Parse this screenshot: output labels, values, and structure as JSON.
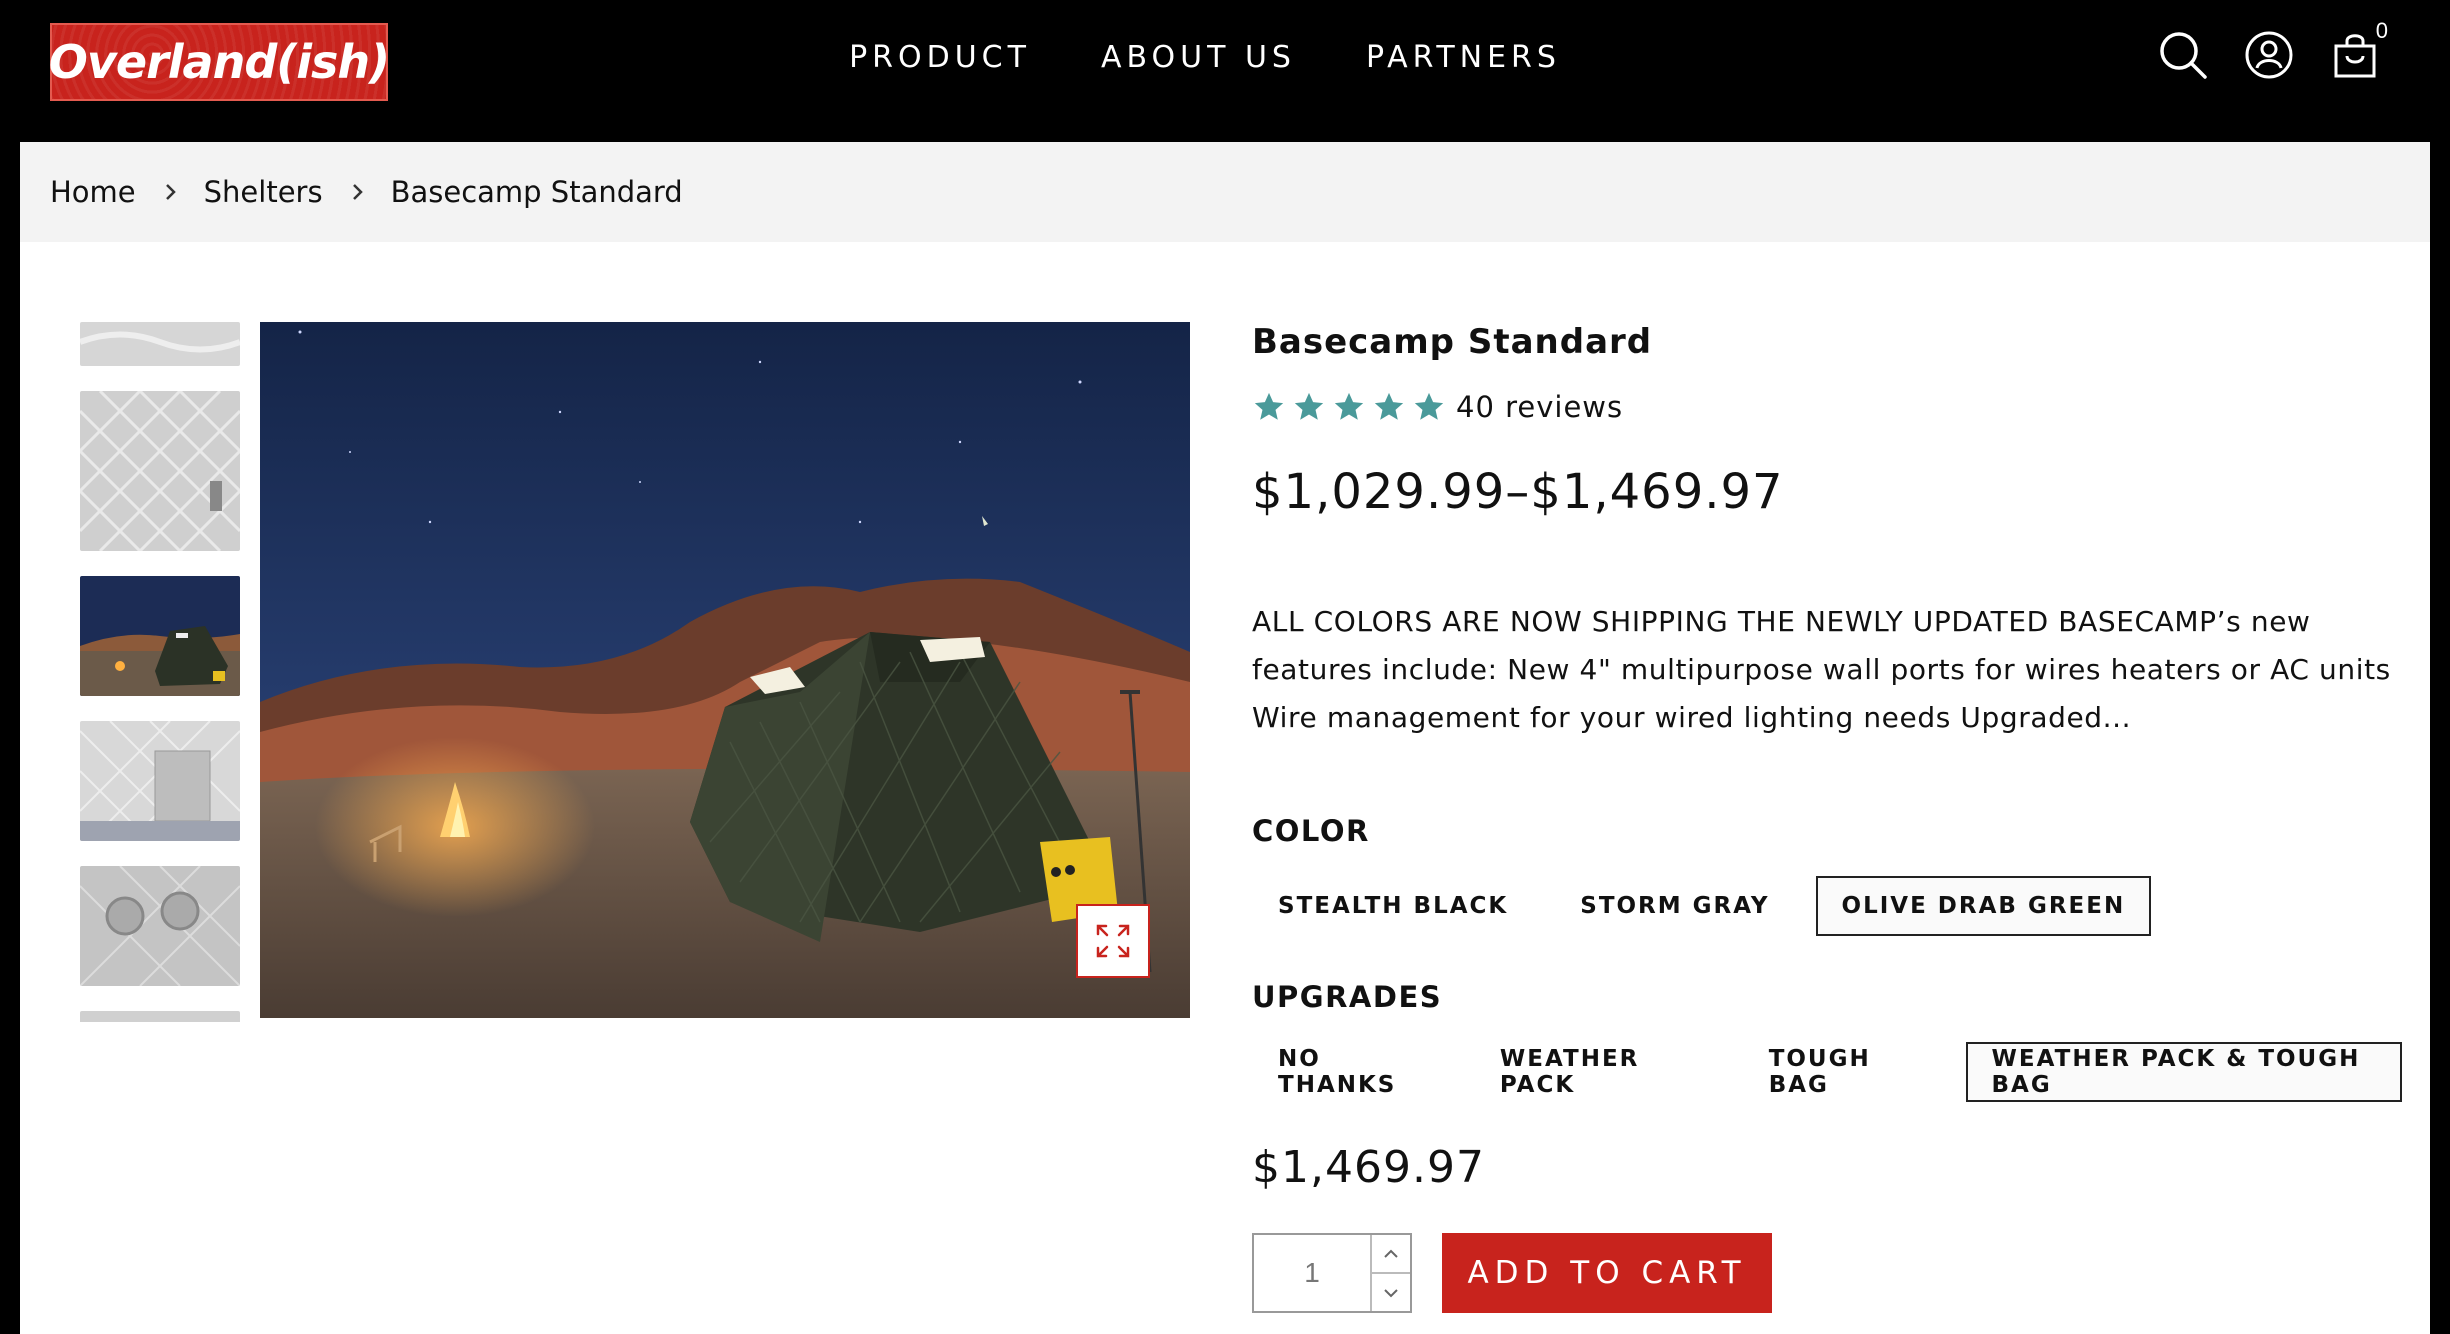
{
  "header": {
    "logo_text": "Overland(ish)",
    "nav": [
      "PRODUCT",
      "ABOUT US",
      "PARTNERS"
    ],
    "cart_count": "0"
  },
  "breadcrumb": [
    "Home",
    "Shelters",
    "Basecamp Standard"
  ],
  "product": {
    "title": "Basecamp Standard",
    "rating": 5,
    "reviews": "40 reviews",
    "price_range": "$1,029.99–$1,469.97",
    "description": "ALL COLORS ARE NOW SHIPPING THE NEWLY UPDATED BASECAMP’s new features include: New 4\" multipurpose wall ports for wires heaters or AC units Wire management for your wired lighting needs Upgraded...",
    "color_label": "COLOR",
    "colors": [
      "STEALTH BLACK",
      "STORM GRAY",
      "OLIVE DRAB GREEN"
    ],
    "selected_color": "OLIVE DRAB GREEN",
    "upgrades_label": "UPGRADES",
    "upgrades": [
      "NO THANKS",
      "WEATHER PACK",
      "TOUGH BAG",
      "WEATHER PACK & TOUGH BAG"
    ],
    "selected_upgrade": "WEATHER PACK & TOUGH BAG",
    "price": "$1,469.97",
    "quantity": "1",
    "add_to_cart": "ADD TO CART"
  },
  "colors": {
    "brand_red": "#c8231d",
    "star": "#4a9a9a"
  }
}
